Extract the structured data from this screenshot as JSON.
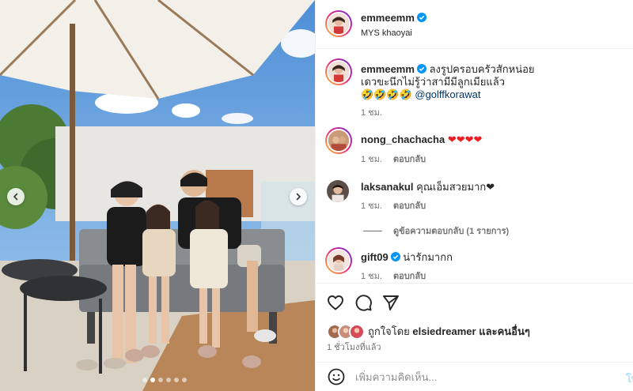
{
  "post": {
    "username": "emmeemm",
    "location": "MYS khaoyai"
  },
  "caption": {
    "username": "emmeemm",
    "text": "ลงรูปครอบครัวสักหน่อย",
    "line2": "เดวขะนึกไม่รู้ว่าสามีมีลูกเมียแล้ว",
    "emojis": "🤣🤣🤣🤣",
    "mention": "@golffkorawat",
    "time": "1 ชม."
  },
  "comments": [
    {
      "username": "nong_chachacha",
      "text": "❤❤❤❤",
      "time": "1 ชม.",
      "reply_label": "ตอบกลับ",
      "verified": false
    },
    {
      "username": "laksanakul",
      "text": "คุณเอ็มสวยมาก❤",
      "time": "1 ชม.",
      "reply_label": "ตอบกลับ",
      "verified": false
    },
    {
      "username": "gift09",
      "text": "น่ารักมากก",
      "time": "1 ชม.",
      "reply_label": "ตอบกลับ",
      "verified": true
    }
  ],
  "view_replies": "ดูข้อความตอบกลับ (1 รายการ)",
  "likes": {
    "prefix": "ถูกใจโดย",
    "liked_by": "elsiedreamer",
    "suffix_joiner": "และ",
    "others": "คนอื่นๆ"
  },
  "time_ago": "1 ชั่วโมงที่แล้ว",
  "add_comment": {
    "placeholder": "เพิ่มความคิดเห็น...",
    "post_label": "โพ"
  },
  "carousel": {
    "current_index": 1,
    "total": 6
  },
  "colors": {
    "verified": "#0095f6",
    "mention": "#00376b",
    "muted": "#737373"
  },
  "icons": [
    "chevron-left-icon",
    "chevron-right-icon",
    "heart-icon",
    "comment-icon",
    "share-icon",
    "emoji-icon",
    "verified-badge-icon"
  ]
}
